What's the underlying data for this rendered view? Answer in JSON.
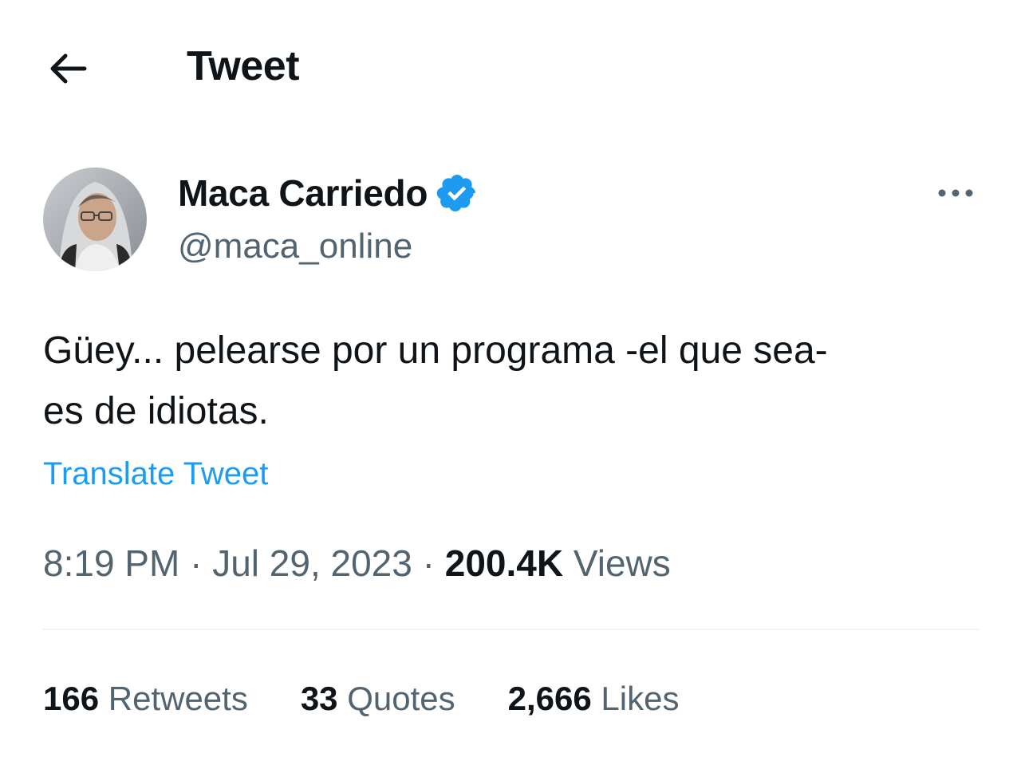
{
  "header": {
    "title": "Tweet",
    "back_icon": "arrow-left-icon"
  },
  "author": {
    "display_name": "Maca Carriedo",
    "handle": "@maca_online",
    "verified": true,
    "verified_color": "#1d9bf0"
  },
  "tweet": {
    "text": "Güey... pelearse por un programa -el que sea-\nes de idiotas.",
    "translate_label": "Translate Tweet",
    "time": "8:19 PM",
    "separator": "·",
    "date": "Jul 29, 2023",
    "views_count": "200.4K",
    "views_label": "Views"
  },
  "stats": {
    "retweets_count": "166",
    "retweets_label": "Retweets",
    "quotes_count": "33",
    "quotes_label": "Quotes",
    "likes_count": "2,666",
    "likes_label": "Likes"
  },
  "colors": {
    "accent": "#1d9bf0",
    "secondary_text": "#536471",
    "primary_text": "#0f1419"
  }
}
